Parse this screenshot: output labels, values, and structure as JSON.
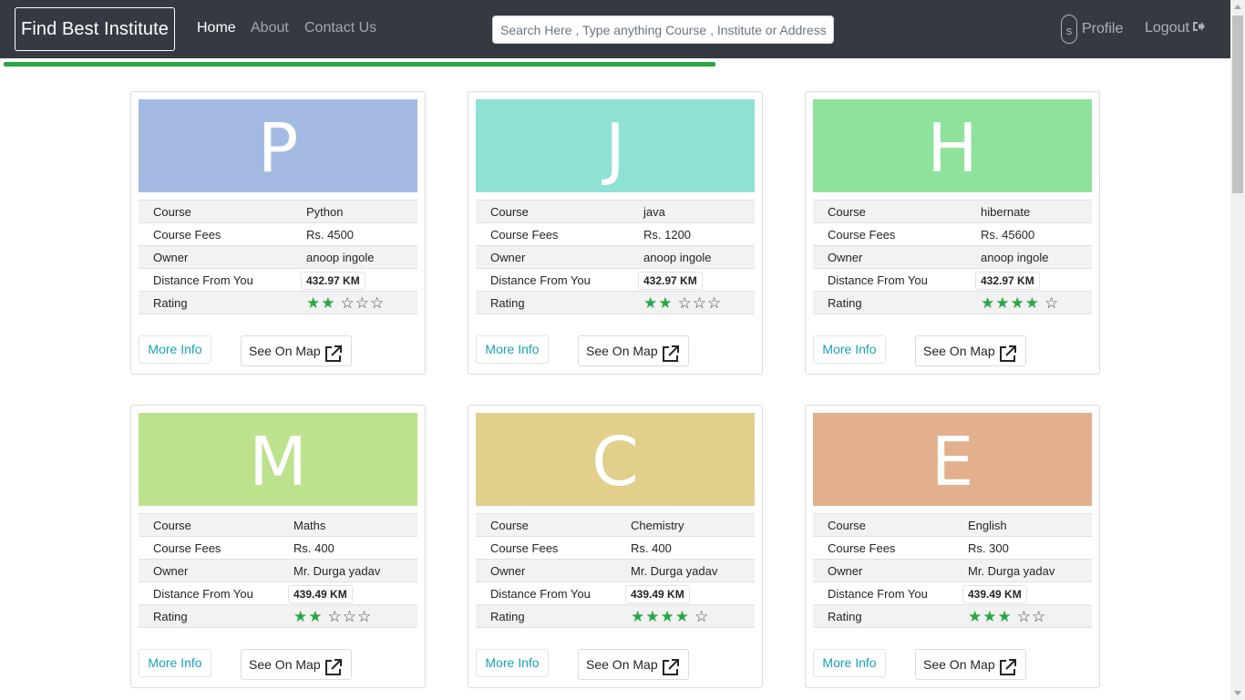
{
  "navbar": {
    "brand": "Find Best Institute",
    "links": [
      "Home",
      "About",
      "Contact Us"
    ],
    "search_placeholder": "Search Here , Type anything Course , Institute or Address",
    "avatar_initial": "s",
    "profile_label": "Profile",
    "logout_label": "Logout"
  },
  "progress": {
    "percent": 58,
    "color": "#28a745"
  },
  "labels": {
    "course": "Course",
    "fees": "Course Fees",
    "owner": "Owner",
    "distance": "Distance From You",
    "rating": "Rating",
    "more_info": "More Info",
    "see_on_map": "See On Map"
  },
  "cards": [
    {
      "letter": "P",
      "color": "#a3bbe3",
      "course": "Python",
      "fees": "Rs. 4500",
      "owner": "anoop ingole",
      "distance": "432.97 KM",
      "rating": 2
    },
    {
      "letter": "J",
      "color": "#8fe2d3",
      "course": "java",
      "fees": "Rs. 1200",
      "owner": "anoop ingole",
      "distance": "432.97 KM",
      "rating": 2
    },
    {
      "letter": "H",
      "color": "#8ee29b",
      "course": "hibernate",
      "fees": "Rs. 45600",
      "owner": "anoop ingole",
      "distance": "432.97 KM",
      "rating": 4
    },
    {
      "letter": "M",
      "color": "#bce28d",
      "course": "Maths",
      "fees": "Rs. 400",
      "owner": "Mr. Durga yadav",
      "distance": "439.49 KM",
      "rating": 2
    },
    {
      "letter": "C",
      "color": "#e1cf8b",
      "course": "Chemistry",
      "fees": "Rs. 400",
      "owner": "Mr. Durga yadav",
      "distance": "439.49 KM",
      "rating": 4
    },
    {
      "letter": "E",
      "color": "#e2b08d",
      "course": "English",
      "fees": "Rs. 300",
      "owner": "Mr. Durga yadav",
      "distance": "439.49 KM",
      "rating": 3
    }
  ]
}
